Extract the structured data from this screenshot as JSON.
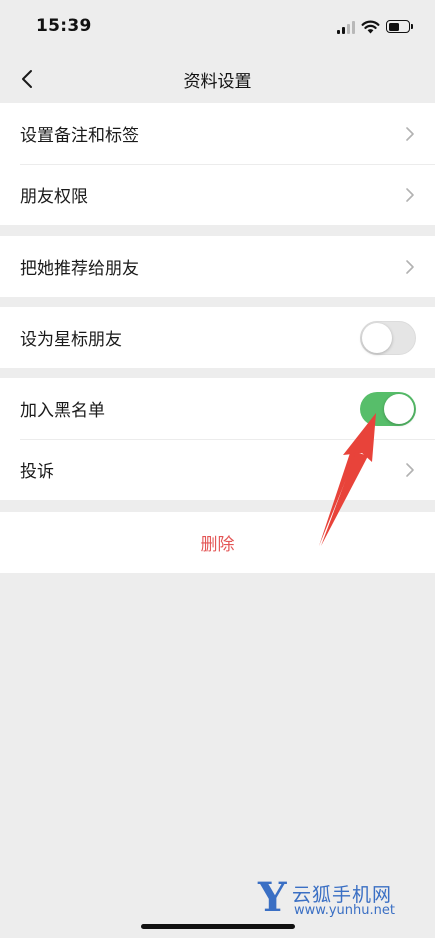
{
  "status_bar": {
    "time": "15:39",
    "icons": [
      "signal-icon",
      "wifi-icon",
      "battery-icon"
    ]
  },
  "nav": {
    "back_icon": "chevron-left-icon",
    "title": "资料设置"
  },
  "groups": {
    "remark_and_tags": {
      "label": "设置备注和标签"
    },
    "friend_permissions": {
      "label": "朋友权限"
    },
    "recommend_to_friends": {
      "label": "把她推荐给朋友"
    },
    "star_friend": {
      "label": "设为星标朋友",
      "enabled": false
    },
    "blacklist": {
      "label": "加入黑名单",
      "enabled": true
    },
    "report": {
      "label": "投诉"
    },
    "delete": {
      "label": "删除"
    }
  },
  "colors": {
    "background": "#ededed",
    "toggle_on": "#57be6a",
    "delete_text": "#e35656",
    "annotation_arrow": "#e8433a",
    "watermark": "#3a6fc4"
  },
  "watermark": {
    "logo_letter": "Y",
    "name": "云狐手机网",
    "url": "www.yunhu.net"
  }
}
